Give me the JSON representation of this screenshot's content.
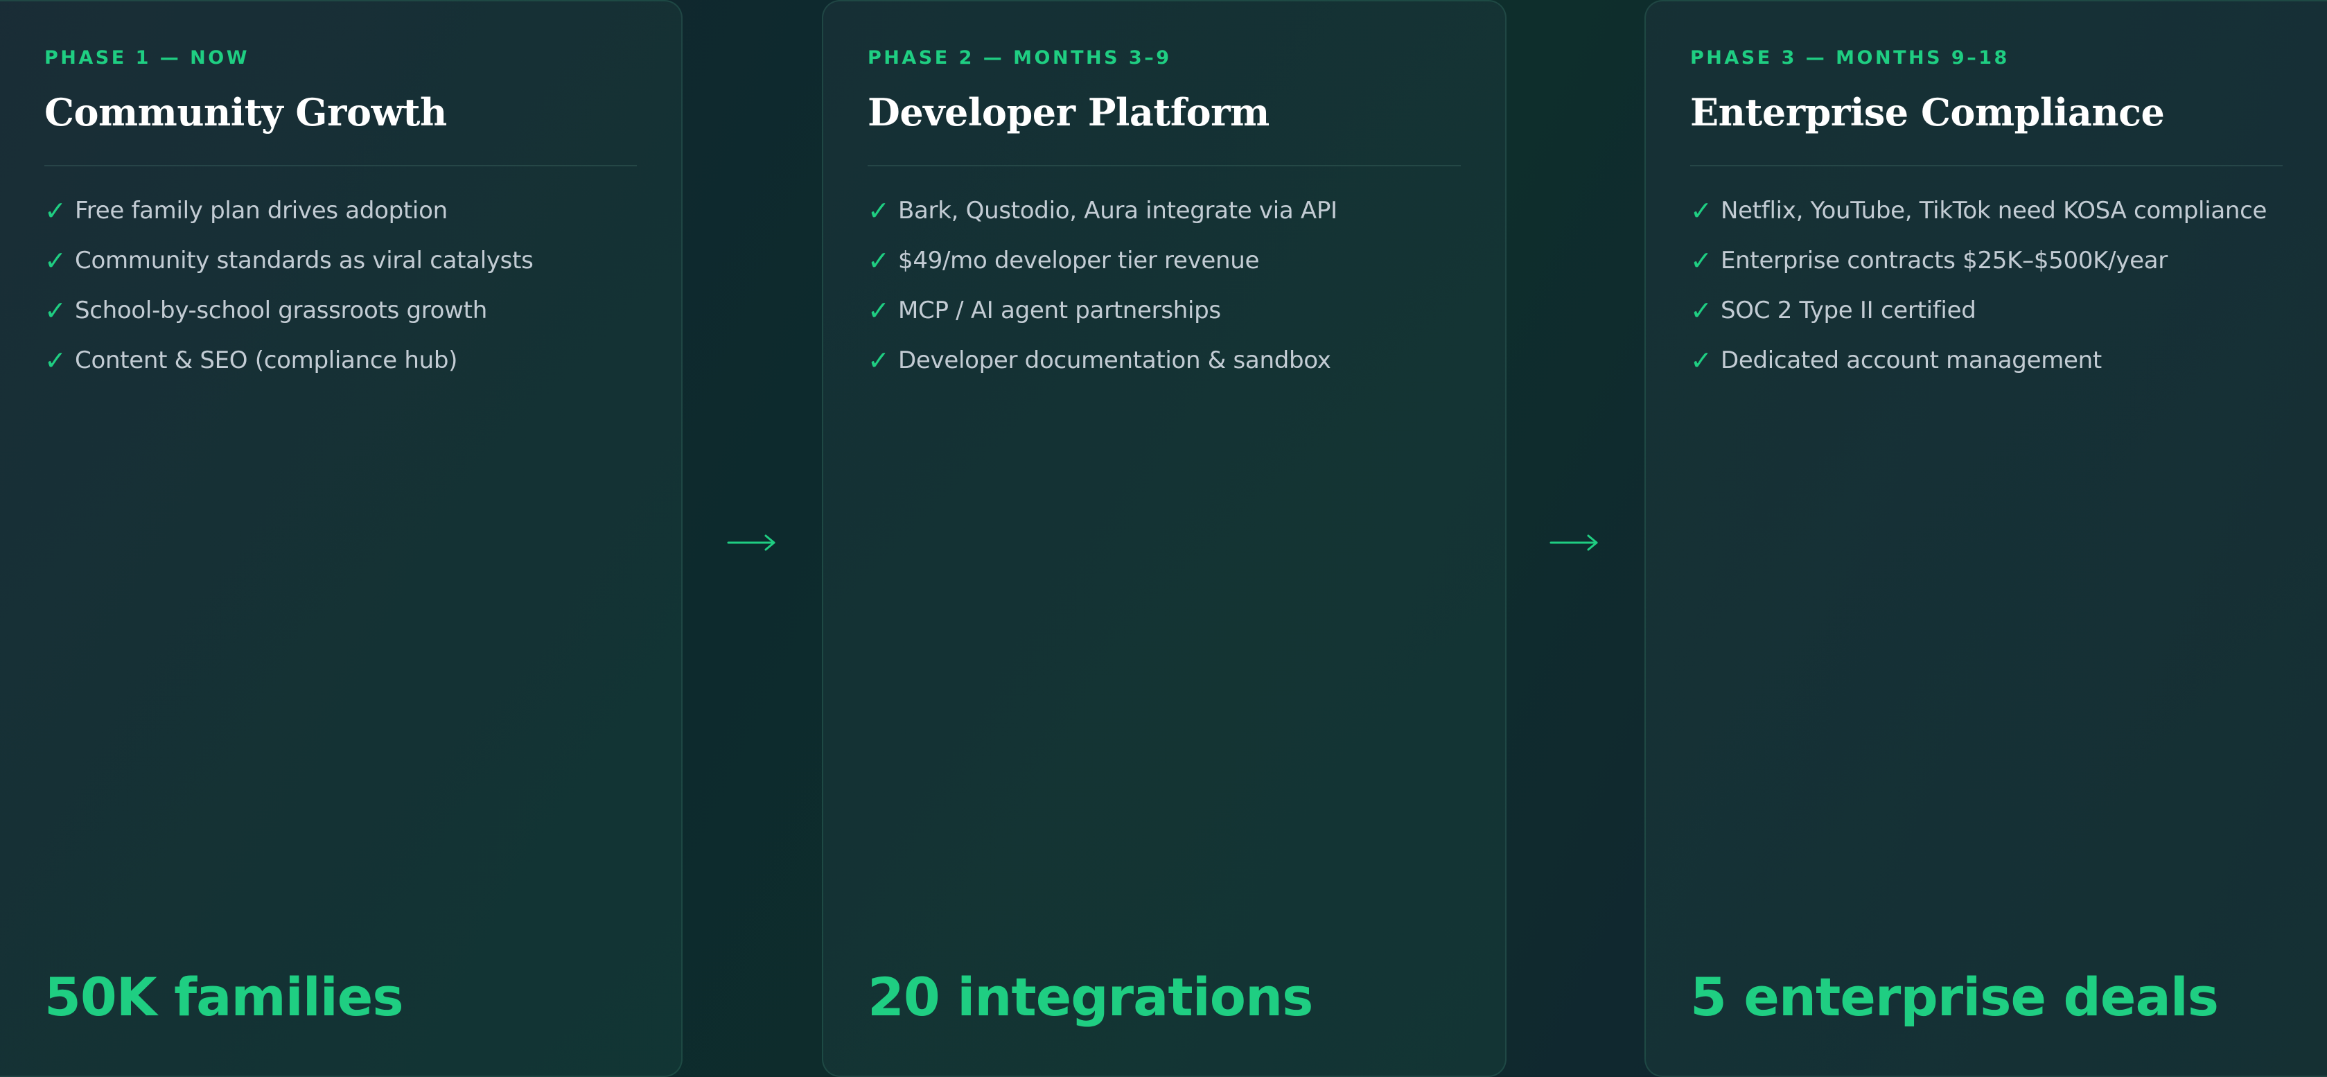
{
  "accent_color": "#1fce82",
  "phases": [
    {
      "label": "PHASE 1 — NOW",
      "title": "Community Growth",
      "items": [
        "Free family plan drives adoption",
        "Community standards as viral catalysts",
        "School-by-school grassroots growth",
        "Content & SEO (compliance hub)"
      ],
      "metric": "50K families"
    },
    {
      "label": "PHASE 2 — MONTHS 3–9",
      "title": "Developer Platform",
      "items": [
        "Bark, Qustodio, Aura integrate via API",
        "$49/mo developer tier revenue",
        "MCP / AI agent partnerships",
        "Developer documentation & sandbox"
      ],
      "metric": "20 integrations"
    },
    {
      "label": "PHASE 3 — MONTHS 9–18",
      "title": "Enterprise Compliance",
      "items": [
        "Netflix, YouTube, TikTok need KOSA compliance",
        "Enterprise contracts $25K–$500K/year",
        "SOC 2 Type II certified",
        "Dedicated account management"
      ],
      "metric": "5 enterprise deals"
    }
  ],
  "icons": {
    "check": "✓",
    "arrow": "arrow-right-icon"
  }
}
